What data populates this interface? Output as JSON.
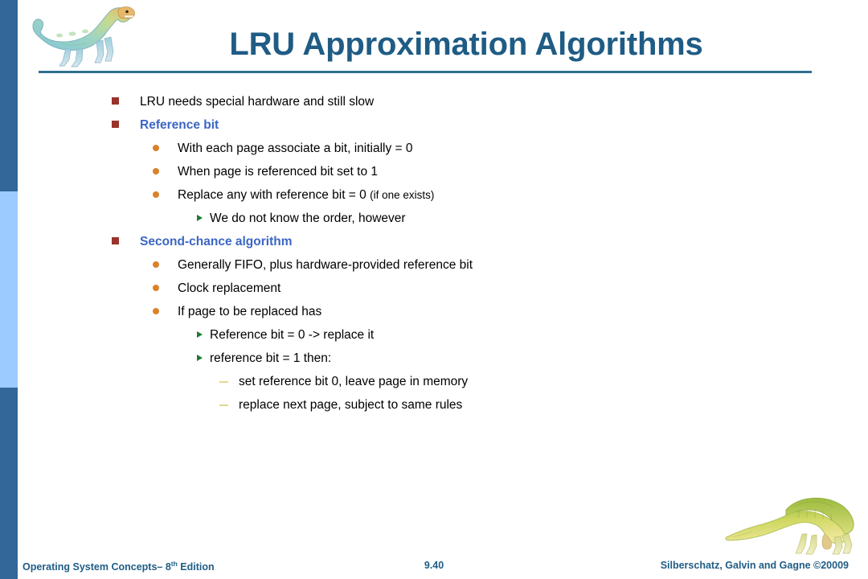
{
  "slide": {
    "title": "LRU Approximation Algorithms",
    "accent_color": "#1F5C85",
    "heading_color": "#3B66C4",
    "rule_color": "#2F6E91"
  },
  "sidebar": {
    "top_color": "#336699",
    "middle_color": "#9BCBFF",
    "bottom_color": "#336699"
  },
  "bullets": {
    "b0": "LRU needs special hardware and still slow",
    "b1": "Reference bit",
    "b2": "With each page associate a bit, initially = 0",
    "b3": "When page is referenced bit set to 1",
    "b4_main": "Replace any with reference bit = 0 ",
    "b4_note": "(if one exists)",
    "b5": "We do not know the order, however",
    "b6": "Second-chance algorithm",
    "b7": "Generally FIFO, plus hardware-provided reference bit",
    "b8": "Clock replacement",
    "b9": "If page to be replaced has",
    "b10": "Reference bit = 0 -> replace it",
    "b11": "reference bit = 1 then:",
    "b12": "set reference bit 0, leave page in memory",
    "b13": "replace next page, subject to same rules"
  },
  "markers": {
    "level1_color": "#99332B",
    "level2_color": "#D9822B",
    "level3_color": "#1E7A32",
    "level4_color": "#E2D98A"
  },
  "footer": {
    "book_title": "Operating System Concepts– 8",
    "edition_sup": "th",
    "edition_suffix": " Edition",
    "page_number": "9.40",
    "copyright": "Silberschatz, Galvin and Gagne ©20009"
  }
}
